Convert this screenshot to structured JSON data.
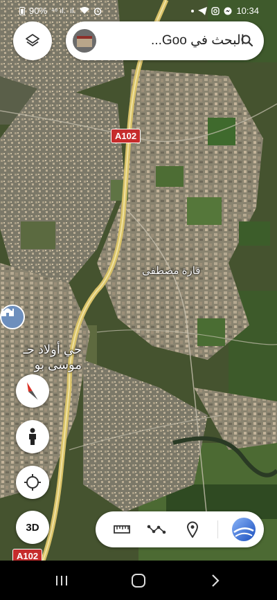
{
  "status": {
    "battery": "90%",
    "signal_left": "⁴⁶ ıl.",
    "signal_right": "ıl.",
    "time": "10:34"
  },
  "search": {
    "text": "البحث في Goo...",
    "thumbnail": "saved-place-photo"
  },
  "map": {
    "road_shields": [
      "A102",
      "A102"
    ],
    "places": {
      "primary": "قارة مصطفى",
      "secondary_line1": "حي أولاد حـ",
      "secondary_line2": "موسى بو"
    },
    "poi_icon": "mosque-icon"
  },
  "controls": {
    "layers_icon": "layers-icon",
    "compass_icon": "compass-icon",
    "streetview_icon": "pegman-icon",
    "mylocation_icon": "crosshair-icon",
    "three_d_label": "3D"
  },
  "toolbar": {
    "tools": [
      "ruler-icon",
      "path-icon",
      "pin-icon",
      "earth-icon"
    ]
  },
  "colors": {
    "road_shield": "#c62c2c",
    "highway": "#e7cf6e",
    "earth_blue": "#1a73e8"
  }
}
